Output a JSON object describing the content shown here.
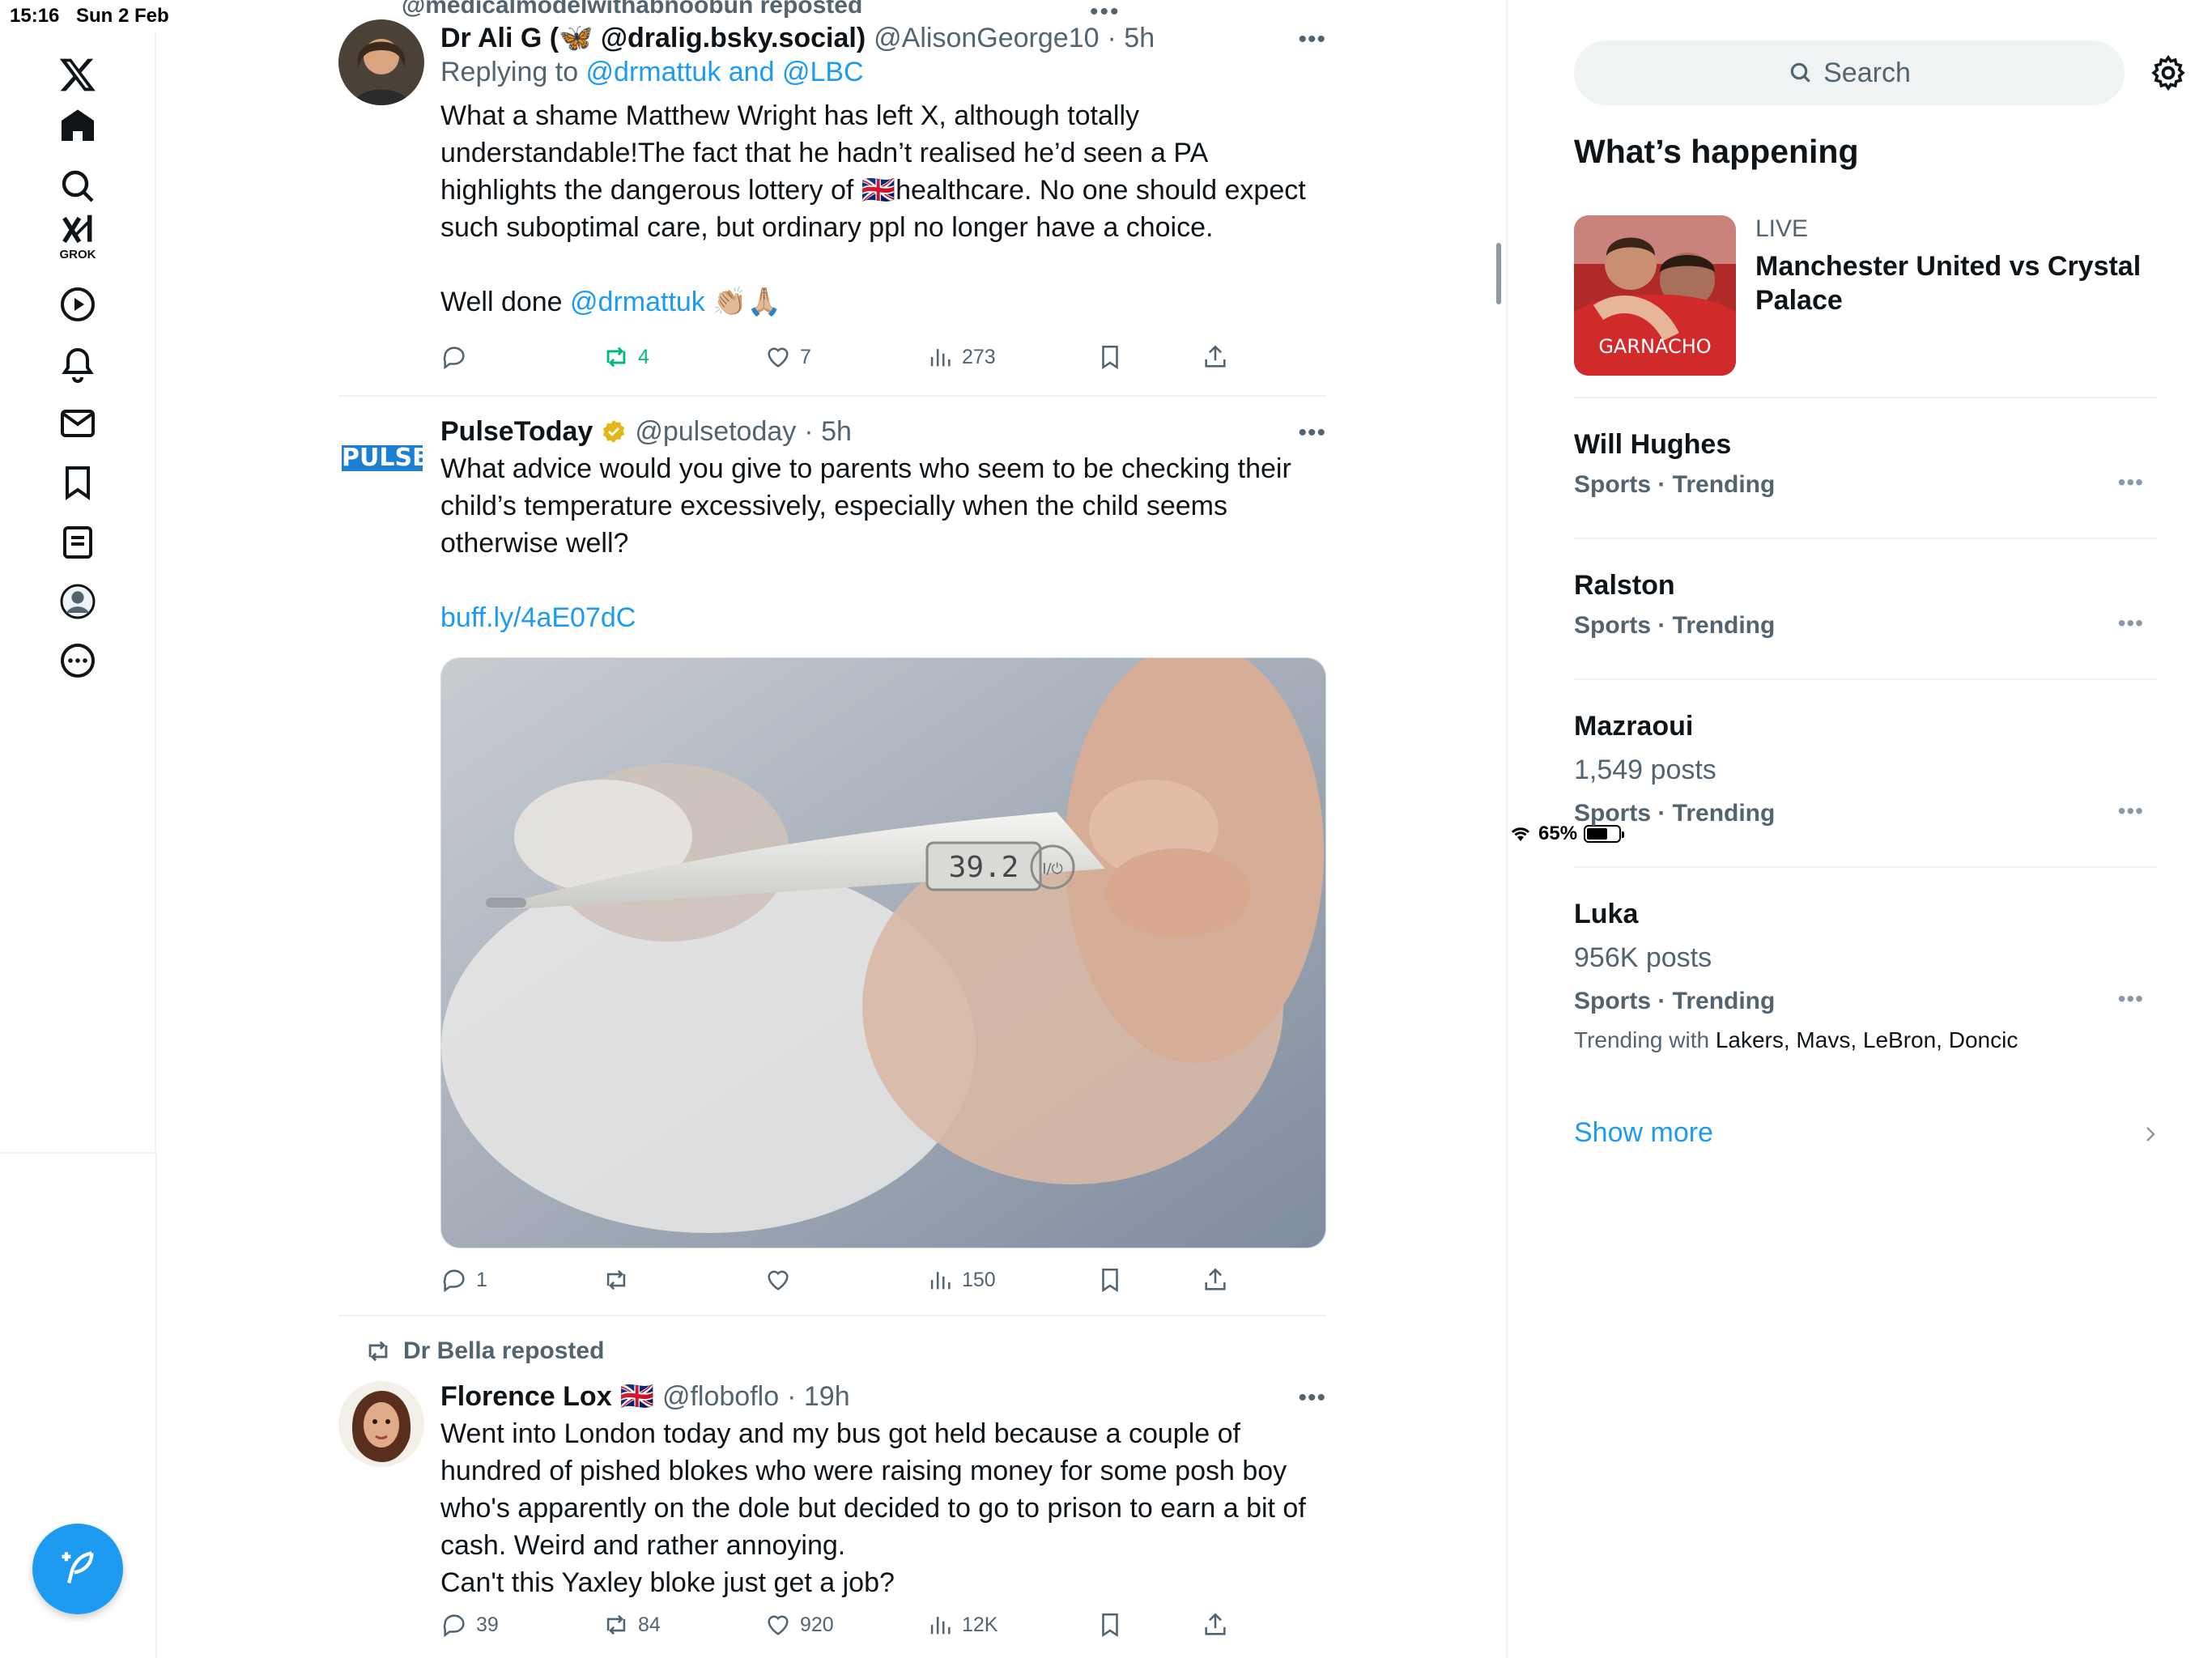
{
  "status_bar": {
    "time": "15:16",
    "date": "Sun 2 Feb",
    "battery": "65%",
    "battery_level": 0.65
  },
  "nav": {
    "items": [
      "x-logo",
      "home",
      "explore",
      "grok",
      "videos",
      "notifications",
      "messages",
      "bookmarks",
      "lists",
      "profile",
      "more"
    ],
    "grok_label": "GROK"
  },
  "feed": {
    "partial_header": "@medicalmodelwithabnoobun reposted",
    "posts": [
      {
        "name": "Dr Ali G (🦋 @dralig.bsky.social)",
        "handle": "@AlisonGeorge10",
        "time": "· 5h",
        "replying_prefix": "Replying to ",
        "replying_to": "@drmattuk and @LBC",
        "text": "What a shame Matthew Wright has left X, although totally understandable!The fact that he hadn’t realised he’d seen a PA highlights the dangerous lottery of 🇬🇧healthcare. No one should expect such suboptimal care, but ordinary ppl no longer have a choice.",
        "text2_prefix": "Well done ",
        "text2_mention": "@drmattuk",
        "text2_emoji": " 👏🏼🙏🏼",
        "replies": "",
        "reposts": "4",
        "likes": "7",
        "views": "273"
      },
      {
        "name": "PulseToday",
        "handle": "@pulsetoday",
        "time": "· 5h",
        "avatar_text": "PULSE",
        "text": "What advice would you give to parents who seem to be checking their child’s temperature excessively, especially when the child seems otherwise well?",
        "link": "buff.ly/4aE07dC",
        "thermometer_reading": "39.2",
        "thermometer_button": "I/⏻",
        "replies": "1",
        "reposts": "",
        "likes": "",
        "views": "150"
      },
      {
        "reposted_by": "Dr Bella reposted",
        "name": "Florence Lox",
        "flag": "🇬🇧",
        "handle": "@floboflo",
        "time": "· 19h",
        "text": "Went into London today and my bus got held because a couple of hundred of pished blokes who were raising money for some posh boy who's apparently on the dole but decided to go to prison to earn a bit of cash. Weird and rather annoying.\nCan't this Yaxley bloke just get a job?",
        "replies": "39",
        "reposts": "84",
        "likes": "920",
        "views": "12K"
      }
    ]
  },
  "sidebar": {
    "search_placeholder": "Search",
    "heading": "What’s happening",
    "live": {
      "label": "LIVE",
      "title": "Manchester United vs Crystal Palace",
      "shirt_text": "GARNACHO"
    },
    "trends": [
      {
        "name": "Will Hughes",
        "count": "",
        "meta": "Sports · Trending",
        "with_prefix": "",
        "with": ""
      },
      {
        "name": "Ralston",
        "count": "",
        "meta": "Sports · Trending",
        "with_prefix": "",
        "with": ""
      },
      {
        "name": "Mazraoui",
        "count": "1,549 posts",
        "meta": "Sports · Trending",
        "with_prefix": "",
        "with": ""
      },
      {
        "name": "Luka",
        "count": "956K posts",
        "meta": "Sports · Trending",
        "with_prefix": "Trending with ",
        "with": "Lakers, Mavs, LeBron, Doncic"
      }
    ],
    "show_more": "Show more"
  },
  "colors": {
    "accent": "#1d9bf0",
    "text": "#0f1419",
    "muted": "#536471",
    "border": "#eff3f4",
    "repost_green": "#00ba7c",
    "verified_gold": "#e2b719"
  }
}
